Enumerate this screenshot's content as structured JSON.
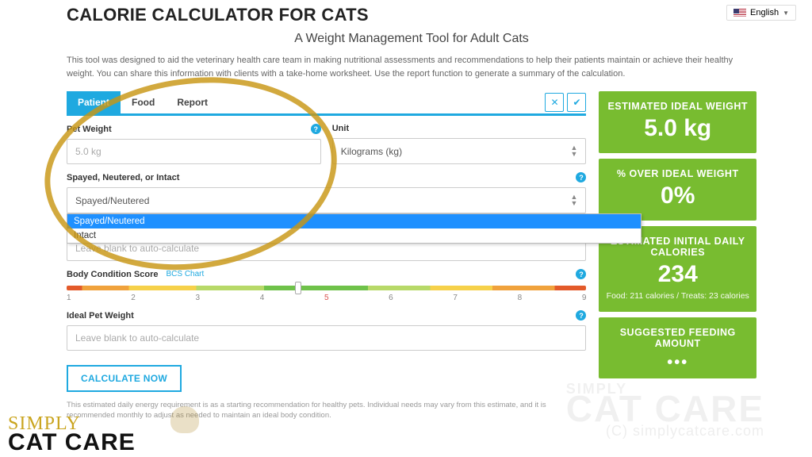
{
  "lang": {
    "label": "English"
  },
  "header": {
    "title": "CALORIE CALCULATOR FOR CATS",
    "subtitle": "A Weight Management Tool for Adult Cats",
    "intro": "This tool was designed to aid the veterinary health care team in making nutritional assessments and recommendations to help their patients maintain or achieve their healthy weight. You can share this information with clients with a take-home worksheet. Use the report function to generate a summary of the calculation."
  },
  "tabs": {
    "patient": "Patient",
    "food": "Food",
    "report": "Report"
  },
  "form": {
    "weight_label": "Pet Weight",
    "weight_placeholder": "5.0 kg",
    "unit_label": "Unit",
    "unit_value": "Kilograms (kg)",
    "status_label": "Spayed, Neutered, or Intact",
    "status_value": "Spayed/Neutered",
    "status_options": [
      "Spayed/Neutered",
      "Intact"
    ],
    "autocalc_placeholder": "Leave blank to auto-calculate",
    "bcs_label": "Body Condition Score",
    "bcs_link": "BCS Chart",
    "bcs_ticks": [
      "1",
      "2",
      "3",
      "4",
      "5",
      "6",
      "7",
      "8",
      "9"
    ],
    "ideal_label": "Ideal Pet Weight",
    "calc_btn": "CALCULATE NOW",
    "disclaimer": "This estimated daily energy requirement is as a starting recommendation for healthy pets. Individual needs may vary from this estimate, and it is recommended monthly to adjust as needed to maintain an ideal body condition."
  },
  "results": {
    "ideal_weight": {
      "title": "ESTIMATED IDEAL WEIGHT",
      "value": "5.0 kg"
    },
    "pct_over": {
      "title": "% OVER IDEAL WEIGHT",
      "value": "0%"
    },
    "calories": {
      "title": "ESTIMATED INITIAL DAILY CALORIES",
      "value": "234",
      "sub": "Food: 211 calories / Treats: 23 calories"
    },
    "feeding": {
      "title": "SUGGESTED FEEDING AMOUNT"
    }
  },
  "brand": {
    "line1": "SIMPLY",
    "line2": "CAT CARE"
  },
  "watermark": {
    "line1": "SIMPLY",
    "line2": "CAT CARE",
    "url": "(C) simplycatcare.com"
  }
}
